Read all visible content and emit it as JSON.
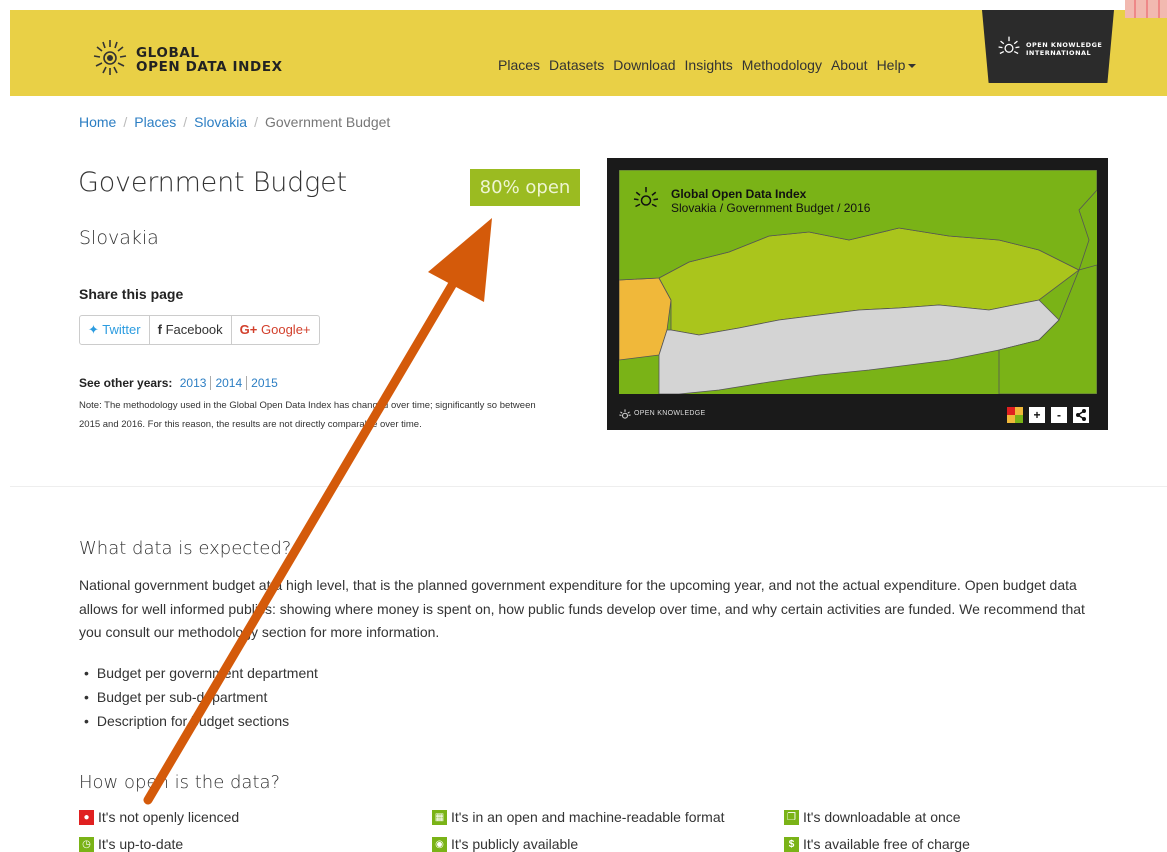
{
  "header": {
    "logo_line1": "GLOBAL",
    "logo_line2": "OPEN DATA INDEX",
    "nav": [
      "Places",
      "Datasets",
      "Download",
      "Insights",
      "Methodology",
      "About"
    ],
    "nav_help": "Help",
    "okfn_line1": "OPEN KNOWLEDGE",
    "okfn_line2": "INTERNATIONAL",
    "brand_color": "#e9d046"
  },
  "breadcrumb": {
    "home": "Home",
    "places": "Places",
    "country": "Slovakia",
    "current": "Government Budget"
  },
  "page": {
    "title": "Government Budget",
    "open_badge": "80% open",
    "badge_color": "#9bbb21",
    "place": "Slovakia"
  },
  "share": {
    "title": "Share this page",
    "twitter": "Twitter",
    "facebook": "Facebook",
    "google": "Google+"
  },
  "years": {
    "label": "See other years:",
    "links": [
      "2013",
      "2014",
      "2015"
    ],
    "note": "Note: The methodology used in the Global Open Data Index has changed over time; significantly so between 2015 and 2016. For this reason, the results are not directly comparable over time."
  },
  "map": {
    "title": "Global Open Data Index",
    "subtitle": "Slovakia / Government Budget / 2016",
    "footer": "OPEN KNOWLEDGE",
    "zoom_in": "+",
    "zoom_out": "-"
  },
  "expected": {
    "heading": "What data is expected?",
    "text": "National government budget at a high level, that is the planned government expenditure for the upcoming year, and not the actual expenditure. Open budget data allows for well informed publics: showing where money is spent on, how public funds develop over time, and why certain activities are funded. We recommend that you consult our methodology section for more information.",
    "items": [
      "Budget per government department",
      "Budget per sub-department",
      "Description for budget sections"
    ]
  },
  "openness": {
    "heading": "How open is the data?",
    "items": [
      {
        "label": "It's not openly licenced",
        "icon": "lock-icon",
        "color": "#e02020"
      },
      {
        "label": "It's in an open and machine-readable format",
        "icon": "keyboard-icon",
        "color": "#7ab317"
      },
      {
        "label": "It's downloadable at once",
        "icon": "files-icon",
        "color": "#7ab317"
      },
      {
        "label": "It's up-to-date",
        "icon": "clock-icon",
        "color": "#7ab317"
      },
      {
        "label": "It's publicly available",
        "icon": "eye-icon",
        "color": "#7ab317"
      },
      {
        "label": "It's available free of charge",
        "icon": "dollar-icon",
        "color": "#7ab317"
      }
    ]
  }
}
